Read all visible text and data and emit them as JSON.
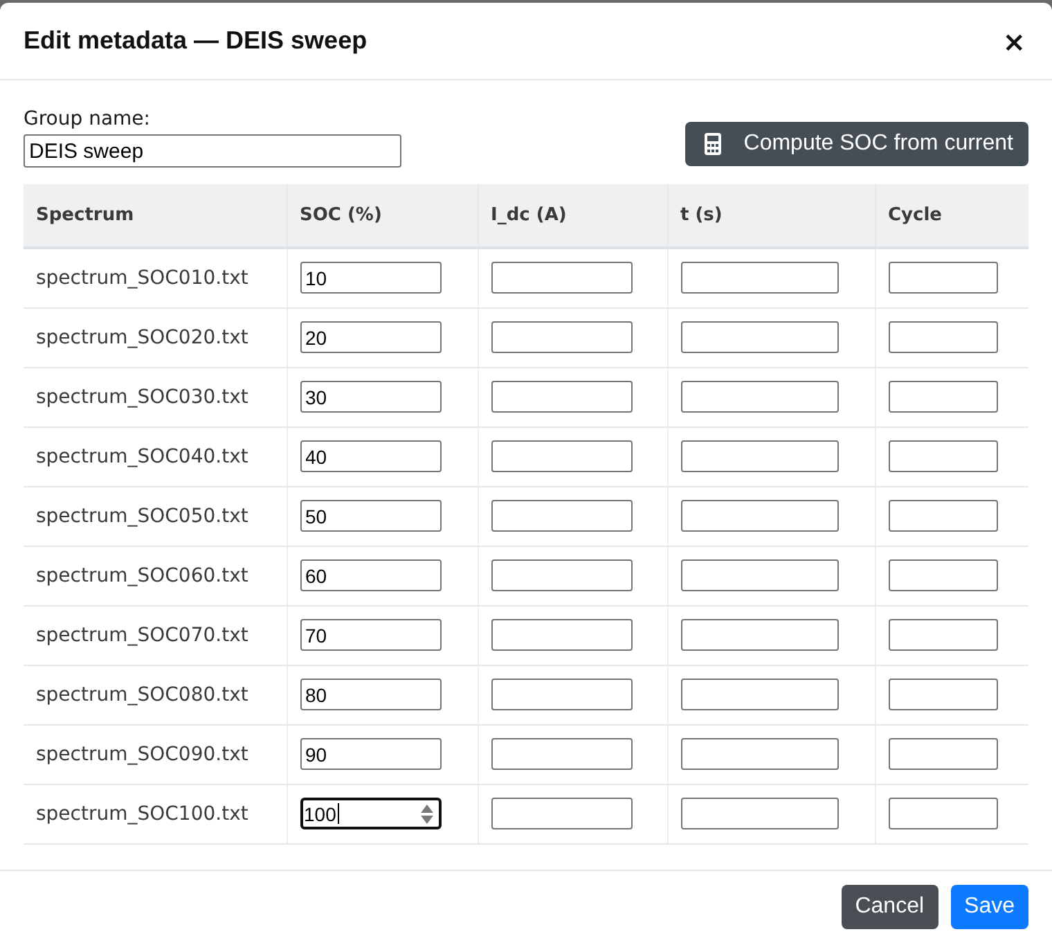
{
  "dialog": {
    "title": "Edit metadata — DEIS sweep",
    "close": "×"
  },
  "group_name": {
    "label": "Group name:",
    "value": "DEIS sweep"
  },
  "compute_button": {
    "label": "Compute SOC from current"
  },
  "table": {
    "columns": [
      "Spectrum",
      "SOC (%)",
      "I_dc (A)",
      "t (s)",
      "Cycle"
    ],
    "rows": [
      {
        "spectrum": "spectrum_SOC010.txt",
        "soc": "10",
        "focused": false
      },
      {
        "spectrum": "spectrum_SOC020.txt",
        "soc": "20",
        "focused": false
      },
      {
        "spectrum": "spectrum_SOC030.txt",
        "soc": "30",
        "focused": false
      },
      {
        "spectrum": "spectrum_SOC040.txt",
        "soc": "40",
        "focused": false
      },
      {
        "spectrum": "spectrum_SOC050.txt",
        "soc": "50",
        "focused": false
      },
      {
        "spectrum": "spectrum_SOC060.txt",
        "soc": "60",
        "focused": false
      },
      {
        "spectrum": "spectrum_SOC070.txt",
        "soc": "70",
        "focused": false
      },
      {
        "spectrum": "spectrum_SOC080.txt",
        "soc": "80",
        "focused": false
      },
      {
        "spectrum": "spectrum_SOC090.txt",
        "soc": "90",
        "focused": false
      },
      {
        "spectrum": "spectrum_SOC100.txt",
        "soc": "100",
        "focused": true
      }
    ]
  },
  "footer_buttons": [
    {
      "label": "Cancel",
      "kind": "secondary"
    },
    {
      "label": "Save",
      "kind": "primary"
    }
  ]
}
